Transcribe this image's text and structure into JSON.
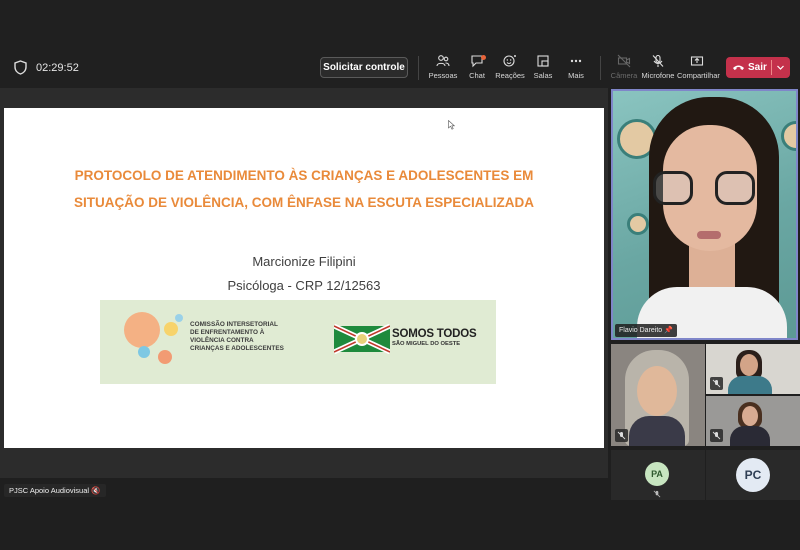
{
  "header": {
    "timer": "02:29:52",
    "request_control": "Solicitar controle",
    "tools": [
      {
        "label": "Pessoas",
        "icon": "people-icon"
      },
      {
        "label": "Chat",
        "icon": "chat-icon"
      },
      {
        "label": "Reações",
        "icon": "reactions-icon"
      },
      {
        "label": "Salas",
        "icon": "rooms-icon"
      },
      {
        "label": "Mais",
        "icon": "more-icon"
      }
    ],
    "devices": [
      {
        "label": "Câmera",
        "icon": "camera-off-icon"
      },
      {
        "label": "Microfone",
        "icon": "mic-off-icon"
      },
      {
        "label": "Compartilhar",
        "icon": "share-icon"
      }
    ],
    "leave_label": "Sair"
  },
  "slide": {
    "title_line1": "PROTOCOLO DE ATENDIMENTO ÀS CRIANÇAS E ADOLESCENTES EM",
    "title_line2": "SITUAÇÃO DE VIOLÊNCIA, COM ÊNFASE NA ESCUTA ESPECIALIZADA",
    "presenter_name": "Marcionize Filipini",
    "presenter_role": "Psicóloga - CRP 12/12563",
    "banner": {
      "commission_line1": "COMISSÃO INTERSETORIAL",
      "commission_line2": "DE ENFRENTAMENTO À",
      "commission_line3": "VIOLÊNCIA CONTRA",
      "commission_line4": "CRIANÇAS E ADOLESCENTES",
      "slogan": "SOMOS TODOS",
      "city": "SÃO MIGUEL DO OESTE"
    }
  },
  "participants": {
    "speaker_name": "Flavio Dareito",
    "avatar1_initials": "PA",
    "avatar2_initials": "PC",
    "screen_share_by": "PJSC Apoio Audiovisual"
  },
  "colors": {
    "accent_leave": "#c4314b",
    "slide_title": "#e98a3a",
    "speaker_border": "#7f86c9"
  }
}
